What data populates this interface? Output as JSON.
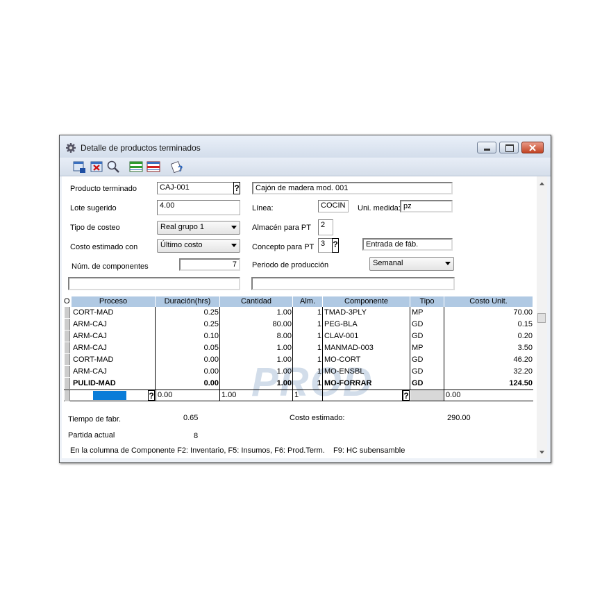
{
  "window": {
    "title": "Detalle de productos terminados"
  },
  "toolbar": {
    "icons": [
      "save-icon",
      "delete-icon",
      "search-icon",
      "insert-row-icon",
      "delete-row-icon",
      "help-icon"
    ]
  },
  "form": {
    "producto_terminado_label": "Producto terminado",
    "producto_terminado_value": "CAJ-001",
    "producto_desc_value": "Cajón de madera mod. 001",
    "lote_label": "Lote sugerido",
    "lote_value": "4.00",
    "linea_label": "Línea:",
    "linea_value": "COCIN",
    "uni_medida_label": "Uni. medida:",
    "uni_medida_value": "pz",
    "tipo_costeo_label": "Tipo de costeo",
    "tipo_costeo_value": "Real grupo 1",
    "almacen_label": "Almacén para PT",
    "almacen_value": "2",
    "costo_estimado_con_label": "Costo estimado con",
    "costo_estimado_con_value": "Último costo",
    "concepto_label": "Concepto para PT",
    "concepto_value": "3",
    "concepto_desc_value": "Entrada de fáb.",
    "num_comp_label": "Núm. de componentes",
    "num_comp_value": "7",
    "periodo_label": "Periodo de producción",
    "periodo_value": "Semanal",
    "question_mark": "?"
  },
  "grid": {
    "headers": [
      "O",
      "Proceso",
      "Duración(hrs)",
      "Cantidad",
      "Alm.",
      "Componente",
      "Tipo",
      "Costo Unit."
    ],
    "rows": [
      {
        "proceso": "CORT-MAD",
        "duracion": "0.25",
        "cantidad": "1.00",
        "alm": "1",
        "componente": "TMAD-3PLY",
        "tipo": "MP",
        "costo": "70.00"
      },
      {
        "proceso": "ARM-CAJ",
        "duracion": "0.25",
        "cantidad": "80.00",
        "alm": "1",
        "componente": "PEG-BLA",
        "tipo": "GD",
        "costo": "0.15"
      },
      {
        "proceso": "ARM-CAJ",
        "duracion": "0.10",
        "cantidad": "8.00",
        "alm": "1",
        "componente": "CLAV-001",
        "tipo": "GD",
        "costo": "0.20"
      },
      {
        "proceso": "ARM-CAJ",
        "duracion": "0.05",
        "cantidad": "1.00",
        "alm": "1",
        "componente": "MANMAD-003",
        "tipo": "MP",
        "costo": "3.50"
      },
      {
        "proceso": "CORT-MAD",
        "duracion": "0.00",
        "cantidad": "1.00",
        "alm": "1",
        "componente": "MO-CORT",
        "tipo": "GD",
        "costo": "46.20"
      },
      {
        "proceso": "ARM-CAJ",
        "duracion": "0.00",
        "cantidad": "1.00",
        "alm": "1",
        "componente": "MO-ENSBL",
        "tipo": "GD",
        "costo": "32.20"
      },
      {
        "proceso": "PULID-MAD",
        "duracion": "0.00",
        "cantidad": "1.00",
        "alm": "1",
        "componente": "MO-FORRAR",
        "tipo": "GD",
        "costo": "124.50"
      }
    ],
    "new_row": {
      "duracion": "0.00",
      "cantidad": "1.00",
      "alm": "1",
      "costo": "0.00"
    },
    "watermark": "PROD"
  },
  "footer": {
    "tiempo_label": "Tiempo de fabr.",
    "tiempo_value": "0.65",
    "costo_label": "Costo estimado:",
    "costo_value": "290.00",
    "partida_label": "Partida actual",
    "partida_value": "8",
    "hint": "En la columna de Componente F2: Inventario, F5: Insumos, F6: Prod.Term.",
    "hint_f9": "F9: HC subensamble"
  },
  "colors": {
    "grid_header": "#b0c9e3",
    "selection": "#0a7cd8"
  }
}
